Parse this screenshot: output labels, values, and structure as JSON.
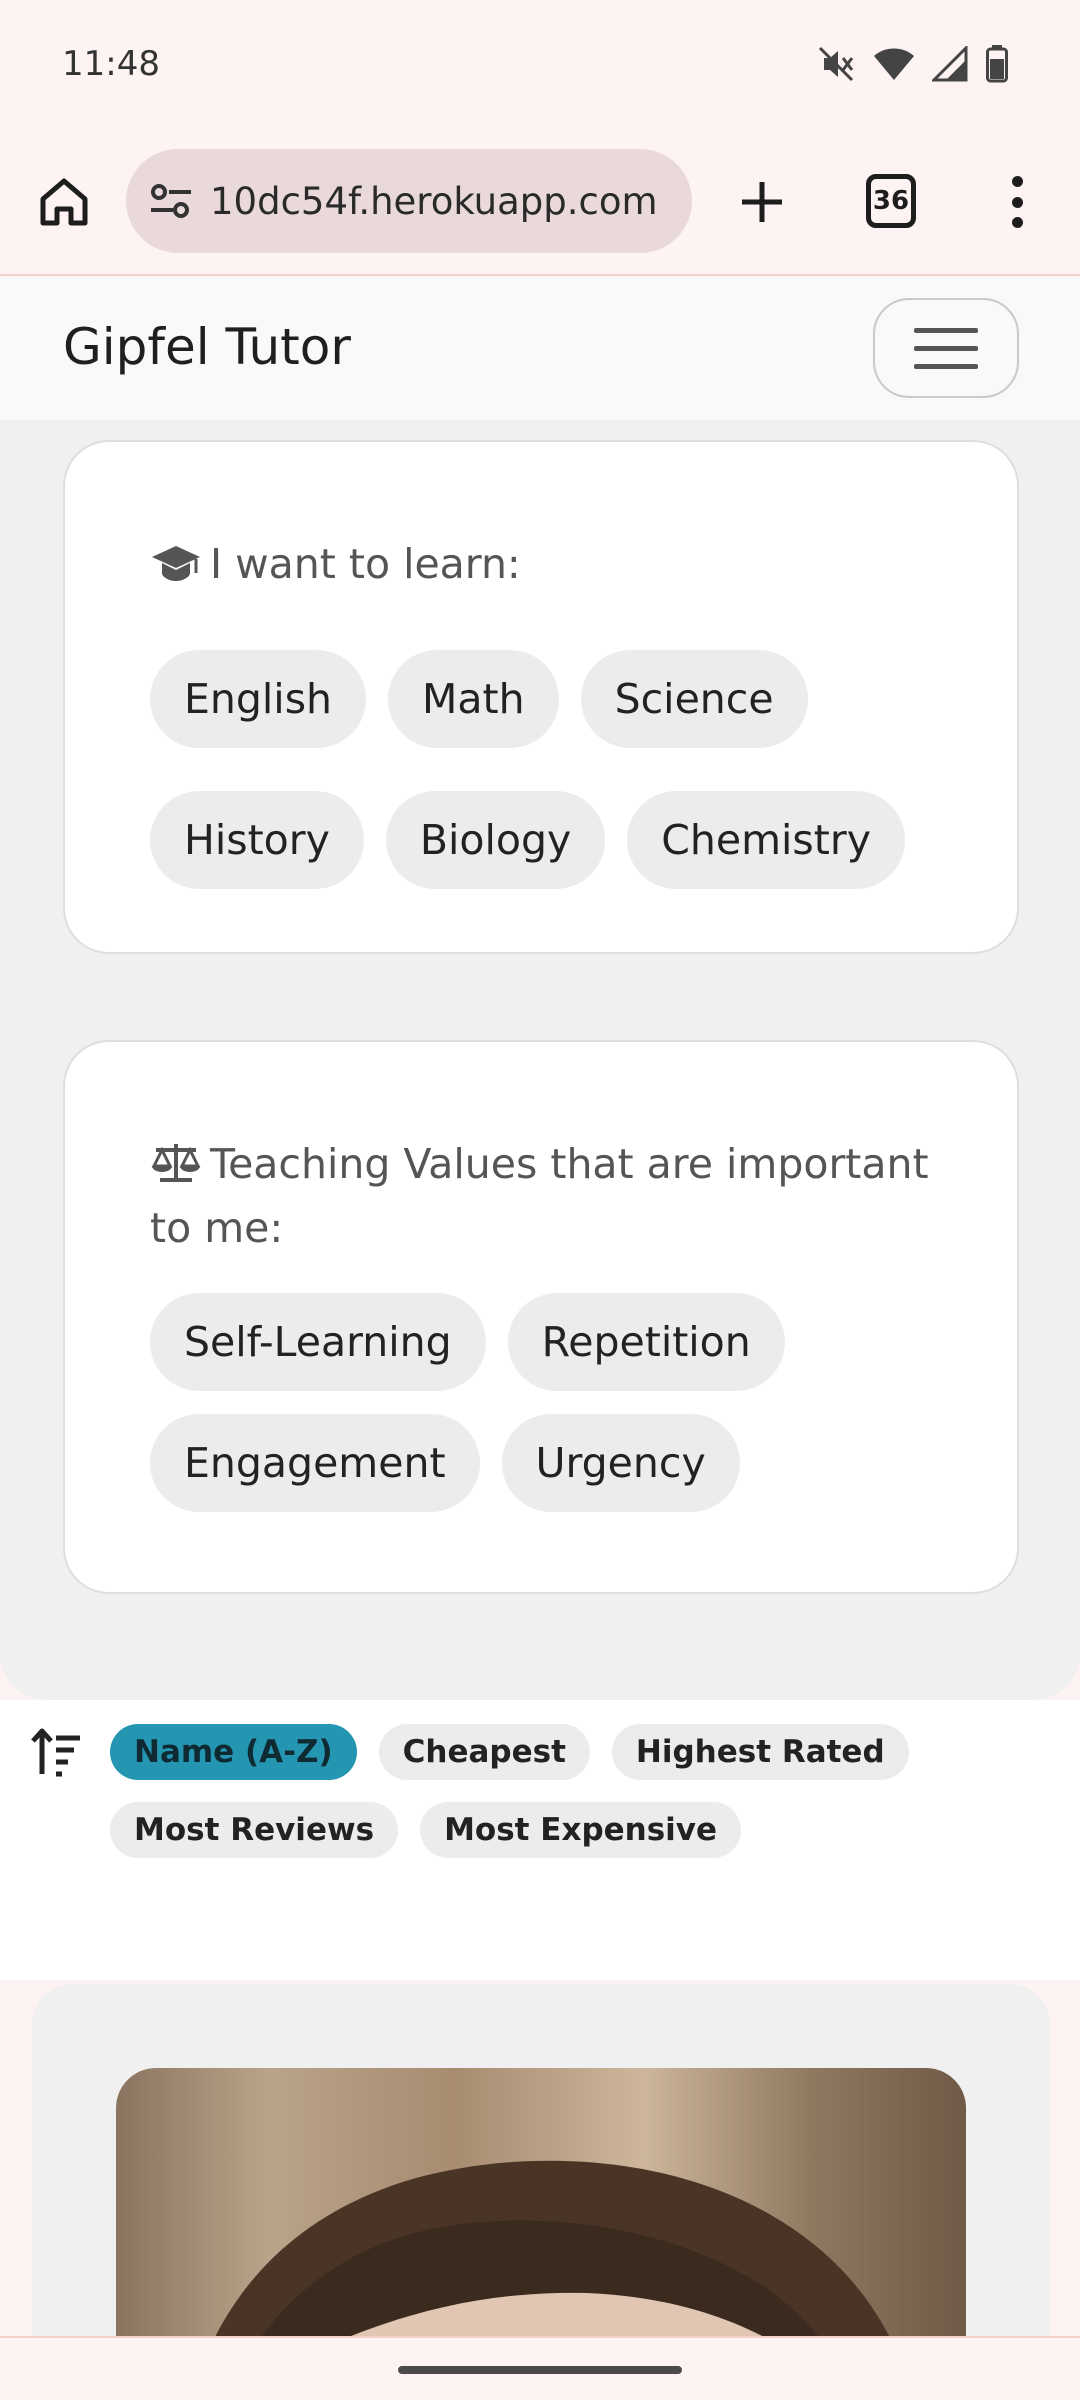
{
  "status_bar": {
    "time": "11:48",
    "icons": [
      "mute-icon",
      "wifi-icon",
      "signal-icon",
      "battery-icon"
    ]
  },
  "browser": {
    "url": "10dc54f.herokuapp.com",
    "tab_count": "36"
  },
  "site": {
    "brand": "Gipfel Tutor"
  },
  "learn_card": {
    "icon": "graduation-cap-icon",
    "title": "I want to learn:",
    "subjects_row1": [
      "English",
      "Math",
      "Science"
    ],
    "subjects_row2": [
      "History",
      "Biology",
      "Chemistry"
    ]
  },
  "values_card": {
    "icon": "scale-icon",
    "title": "Teaching Values that are important to me:",
    "values_row1": [
      "Self-Learning",
      "Repetition"
    ],
    "values_row2": [
      "Engagement",
      "Urgency"
    ]
  },
  "sort": {
    "icon": "sort-icon",
    "active": "Name (A-Z)",
    "options_row1": [
      "Name (A-Z)",
      "Cheapest",
      "Highest Rated"
    ],
    "options_row2": [
      "Most Reviews",
      "Most Expensive"
    ],
    "active_color": "#2496b1"
  }
}
